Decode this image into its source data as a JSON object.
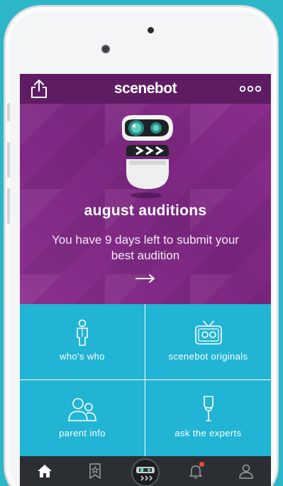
{
  "navbar": {
    "title": "scenebot",
    "share_icon": "share-icon",
    "more_icon": "more-dots-icon"
  },
  "hero": {
    "title": "august auditions",
    "text": "You have 9 days left to submit your best audition",
    "arrow": "→"
  },
  "tiles": [
    {
      "label": "who's who",
      "icon": "person-icon"
    },
    {
      "label": "scenebot originals",
      "icon": "tv-icon"
    },
    {
      "label": "parent info",
      "icon": "parents-icon"
    },
    {
      "label": "ask the experts",
      "icon": "microphone-icon"
    }
  ],
  "tabbar": {
    "items": [
      "home-icon",
      "bookmark-star-icon",
      "scenebot-robot-icon",
      "bell-icon",
      "profile-icon"
    ],
    "notification": true
  },
  "colors": {
    "background": "#2bb7c7",
    "nav": "#5e1d62",
    "hero": "#7b2780",
    "tile": "#21b4d4",
    "tabbar": "#2b2f33",
    "badge": "#e74c3c"
  }
}
